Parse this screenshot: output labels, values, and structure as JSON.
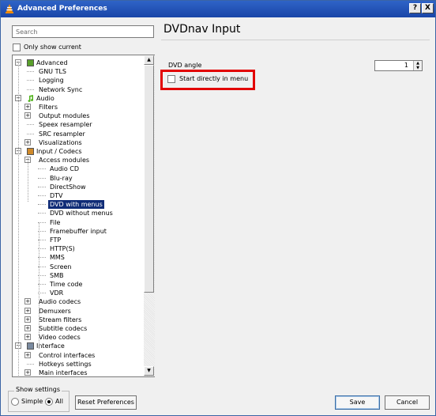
{
  "window": {
    "title": "Advanced Preferences",
    "help_label": "?",
    "close_label": "X"
  },
  "search": {
    "placeholder": "Search",
    "value": ""
  },
  "only_show_current": {
    "label": "Only show current",
    "checked": false
  },
  "tree": {
    "selected": "DVD with menus",
    "rows": [
      {
        "label": "Advanced",
        "level": 0,
        "expander": "-",
        "icon": "advanced-icon"
      },
      {
        "label": "GNU TLS",
        "level": 1
      },
      {
        "label": "Logging",
        "level": 1
      },
      {
        "label": "Network Sync",
        "level": 1
      },
      {
        "label": "Audio",
        "level": 0,
        "expander": "-",
        "icon": "audio-note-icon"
      },
      {
        "label": "Filters",
        "level": 1,
        "expander": "+"
      },
      {
        "label": "Output modules",
        "level": 1,
        "expander": "+"
      },
      {
        "label": "Speex resampler",
        "level": 1
      },
      {
        "label": "SRC resampler",
        "level": 1
      },
      {
        "label": "Visualizations",
        "level": 1,
        "expander": "+"
      },
      {
        "label": "Input / Codecs",
        "level": 0,
        "expander": "-",
        "icon": "input-codecs-icon"
      },
      {
        "label": "Access modules",
        "level": 1,
        "expander": "-"
      },
      {
        "label": "Audio CD",
        "level": 2
      },
      {
        "label": "Blu-ray",
        "level": 2
      },
      {
        "label": "DirectShow",
        "level": 2
      },
      {
        "label": "DTV",
        "level": 2
      },
      {
        "label": "DVD with menus",
        "level": 2
      },
      {
        "label": "DVD without menus",
        "level": 2
      },
      {
        "label": "File",
        "level": 2
      },
      {
        "label": "Framebuffer input",
        "level": 2
      },
      {
        "label": "FTP",
        "level": 2
      },
      {
        "label": "HTTP(S)",
        "level": 2
      },
      {
        "label": "MMS",
        "level": 2
      },
      {
        "label": "Screen",
        "level": 2
      },
      {
        "label": "SMB",
        "level": 2
      },
      {
        "label": "Time code",
        "level": 2
      },
      {
        "label": "VDR",
        "level": 2
      },
      {
        "label": "Audio codecs",
        "level": 1,
        "expander": "+"
      },
      {
        "label": "Demuxers",
        "level": 1,
        "expander": "+"
      },
      {
        "label": "Stream filters",
        "level": 1,
        "expander": "+"
      },
      {
        "label": "Subtitle codecs",
        "level": 1,
        "expander": "+"
      },
      {
        "label": "Video codecs",
        "level": 1,
        "expander": "+"
      },
      {
        "label": "Interface",
        "level": 0,
        "expander": "-",
        "icon": "interface-icon"
      },
      {
        "label": "Control interfaces",
        "level": 1,
        "expander": "+"
      },
      {
        "label": "Hotkeys settings",
        "level": 1
      },
      {
        "label": "Main interfaces",
        "level": 1,
        "expander": "+"
      }
    ]
  },
  "show_settings": {
    "title": "Show settings",
    "simple_label": "Simple",
    "all_label": "All",
    "selected": "All"
  },
  "buttons": {
    "reset": "Reset Preferences",
    "save": "Save",
    "cancel": "Cancel"
  },
  "panel": {
    "title": "DVDnav Input",
    "dvd_angle_label": "DVD angle",
    "dvd_angle_value": "1",
    "start_in_menu_label": "Start directly in menu",
    "start_in_menu_checked": false
  },
  "colors": {
    "highlight_box": "#e20000",
    "selection": "#102c77",
    "titlebar": "#1f4fb4"
  }
}
